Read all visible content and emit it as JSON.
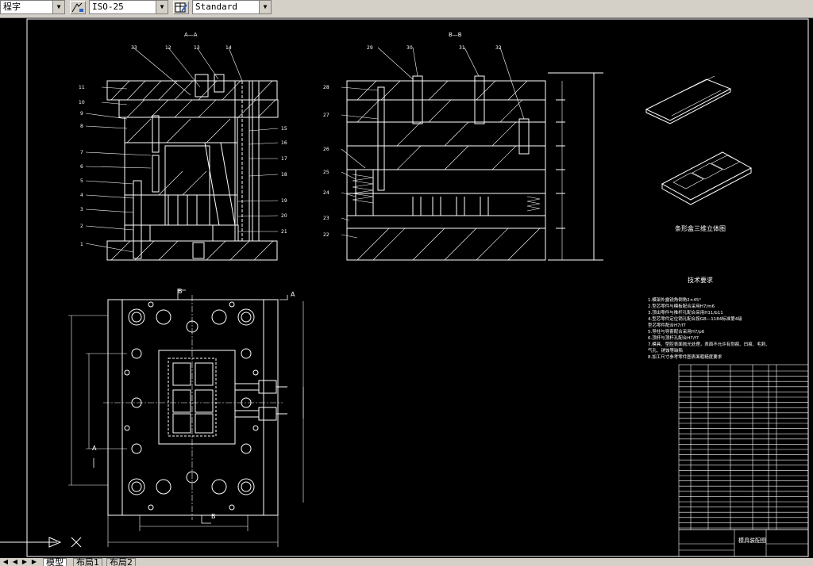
{
  "toolbar": {
    "text_style_value": "程字",
    "dim_style_value": "ISO-25",
    "table_style_value": "Standard",
    "dim_style_icon": "dimension-style-icon",
    "table_style_icon": "table-style-icon"
  },
  "drawing": {
    "section_aa_label": "A—A",
    "section_bb_label": "B—B",
    "section_marker_a": "A",
    "section_marker_b": "B",
    "part_numbers_left": [
      "1",
      "2",
      "3",
      "4",
      "5",
      "6",
      "7",
      "8",
      "9",
      "10",
      "11"
    ],
    "part_numbers_top_left": [
      "33",
      "12",
      "13",
      "14"
    ],
    "part_numbers_right_left_view": [
      "15",
      "16",
      "17",
      "18",
      "19",
      "20",
      "21"
    ],
    "part_numbers_top_right": [
      "29",
      "30",
      "31",
      "32"
    ],
    "part_numbers_left_right_view": [
      "28",
      "27",
      "26",
      "25",
      "24",
      "23",
      "22"
    ],
    "iso_caption": "条形盒三维立体图",
    "tech_title": "技术要求",
    "tech_notes": [
      "1.模架外露锐角倒角2×45°",
      "2.型芯零件与模板配合采用H7/m6",
      "3.顶出零件与推杆孔配合采用H11/b11",
      "4.型芯零件定位销孔配合按GB—1184标准第4级",
      "  型芯零件配合H7/f7",
      "5.导柱与导套配合采用H7/p6",
      "6.顶杆与顶杆孔配合H7/f7",
      "7.模具、型腔表面抛光处理，表面不允许有划痕、凹痕、毛刺、",
      "  气孔、锈蚀等缺陷",
      "8.加工尺寸参考零件图表面粗糙度要求"
    ],
    "title_block_name": "模具装配图"
  },
  "layout_tabs": {
    "model": "模型",
    "layout1": "布局1",
    "layout2": "布局2"
  },
  "colors": {
    "background": "#000000",
    "lines": "#ffffff",
    "toolbar": "#d4d0c8"
  }
}
